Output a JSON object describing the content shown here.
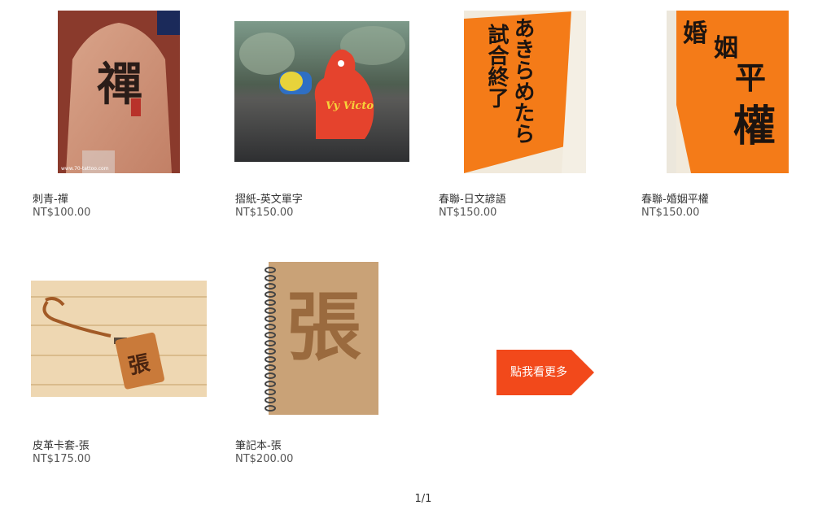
{
  "products": [
    {
      "name": "刺青-禪",
      "price": "NT$100.00",
      "art": "禪",
      "watermark": "www.70-tattoo.com"
    },
    {
      "name": "摺紙-英文單字",
      "price": "NT$150.00",
      "art": "Vy Victo"
    },
    {
      "name": "春聯-日文諺語",
      "price": "NT$150.00",
      "art": "あきらめたら試合終了"
    },
    {
      "name": "春聯-婚姻平權",
      "price": "NT$150.00",
      "art": "婚姻平權"
    },
    {
      "name": "皮革卡套-張",
      "price": "NT$175.00",
      "art": "張"
    },
    {
      "name": "筆記本-張",
      "price": "NT$200.00",
      "art": "張"
    }
  ],
  "more_button": {
    "label": "點我看更多",
    "color": "#f2491b"
  },
  "pagination": {
    "text": "1/1"
  }
}
